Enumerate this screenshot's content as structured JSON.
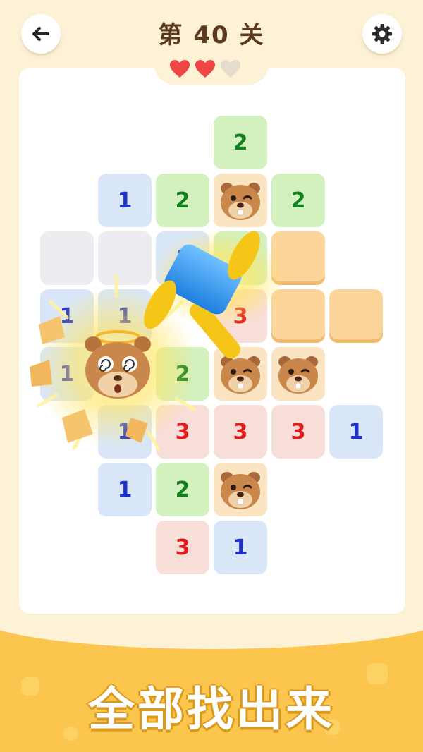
{
  "header": {
    "title": "第 40 关",
    "back_icon": "arrow-left-icon",
    "settings_icon": "gear-icon"
  },
  "lives": {
    "total": 3,
    "remaining": 2
  },
  "board": {
    "cells": [
      {
        "row": 0,
        "col": 3,
        "kind": "number",
        "value": "2",
        "color": "green"
      },
      {
        "row": 1,
        "col": 1,
        "kind": "number",
        "value": "1",
        "color": "blue"
      },
      {
        "row": 1,
        "col": 2,
        "kind": "number",
        "value": "2",
        "color": "green"
      },
      {
        "row": 1,
        "col": 3,
        "kind": "beaver",
        "face": "wink"
      },
      {
        "row": 1,
        "col": 4,
        "kind": "number",
        "value": "2",
        "color": "green"
      },
      {
        "row": 2,
        "col": 0,
        "kind": "empty",
        "color": "gray"
      },
      {
        "row": 2,
        "col": 1,
        "kind": "empty",
        "color": "gray"
      },
      {
        "row": 2,
        "col": 2,
        "kind": "number",
        "value": "1",
        "color": "blue"
      },
      {
        "row": 2,
        "col": 3,
        "kind": "number",
        "value": "2",
        "color": "green"
      },
      {
        "row": 2,
        "col": 4,
        "kind": "hidden",
        "color": "orange"
      },
      {
        "row": 3,
        "col": 0,
        "kind": "number",
        "value": "1",
        "color": "blue"
      },
      {
        "row": 3,
        "col": 1,
        "kind": "number",
        "value": "1",
        "color": "blue"
      },
      {
        "row": 3,
        "col": 3,
        "kind": "number",
        "value": "3",
        "color": "red"
      },
      {
        "row": 3,
        "col": 4,
        "kind": "hidden",
        "color": "orange"
      },
      {
        "row": 3,
        "col": 5,
        "kind": "hidden",
        "color": "orange"
      },
      {
        "row": 4,
        "col": 0,
        "kind": "number",
        "value": "1",
        "color": "blue"
      },
      {
        "row": 4,
        "col": 2,
        "kind": "number",
        "value": "2",
        "color": "green"
      },
      {
        "row": 4,
        "col": 3,
        "kind": "beaver",
        "face": "wink"
      },
      {
        "row": 4,
        "col": 4,
        "kind": "beaver",
        "face": "wink"
      },
      {
        "row": 5,
        "col": 1,
        "kind": "number",
        "value": "1",
        "color": "blue"
      },
      {
        "row": 5,
        "col": 2,
        "kind": "number",
        "value": "3",
        "color": "red"
      },
      {
        "row": 5,
        "col": 3,
        "kind": "number",
        "value": "3",
        "color": "red"
      },
      {
        "row": 5,
        "col": 4,
        "kind": "number",
        "value": "3",
        "color": "red"
      },
      {
        "row": 5,
        "col": 5,
        "kind": "number",
        "value": "1",
        "color": "blue"
      },
      {
        "row": 6,
        "col": 1,
        "kind": "number",
        "value": "1",
        "color": "blue"
      },
      {
        "row": 6,
        "col": 2,
        "kind": "number",
        "value": "2",
        "color": "green"
      },
      {
        "row": 6,
        "col": 3,
        "kind": "beaver",
        "face": "wink"
      },
      {
        "row": 7,
        "col": 2,
        "kind": "number",
        "value": "3",
        "color": "red"
      },
      {
        "row": 7,
        "col": 3,
        "kind": "number",
        "value": "1",
        "color": "blue"
      }
    ]
  },
  "effects": {
    "hammer_icon": "hammer-icon",
    "dizzy_beaver_icon": "dizzy-beaver-icon"
  },
  "footer": {
    "slogan": "全部找出来"
  },
  "colors": {
    "background": "#fdf1d6",
    "board": "#ffffff",
    "blue_tile": "#d9e6f7",
    "blue_text": "#1f2fc9",
    "green_tile": "#d3f0bf",
    "green_text": "#12801e",
    "red_tile": "#f8ded8",
    "red_text": "#e11b1b",
    "orange_tile": "#fcd59a",
    "footer": "#fbc54e",
    "heart_full": "#ef4545",
    "heart_empty": "#e4dccc"
  }
}
